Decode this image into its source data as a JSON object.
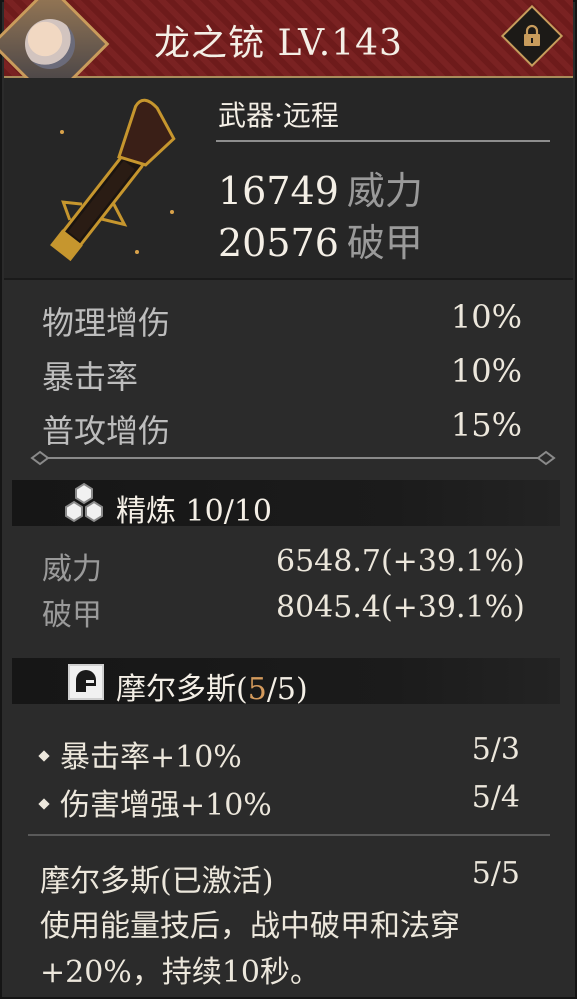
{
  "header": {
    "title": "龙之铳 LV.143"
  },
  "weapon": {
    "category": "武器·远程",
    "stats": [
      {
        "value": "16749",
        "label": "威力"
      },
      {
        "value": "20576",
        "label": "破甲"
      }
    ]
  },
  "attributes": [
    {
      "label": "物理增伤",
      "value": "10%"
    },
    {
      "label": "暴击率",
      "value": "10%"
    },
    {
      "label": "普攻增伤",
      "value": "15%"
    }
  ],
  "refine": {
    "label": "精炼 10/10",
    "rows": [
      {
        "label": "威力",
        "value": "6548.7(+39.1%)"
      },
      {
        "label": "破甲",
        "value": "8045.4(+39.1%)"
      }
    ]
  },
  "set": {
    "name": "摩尔多斯(",
    "count_highlight": "5",
    "count_rest": "/5)",
    "bonuses": [
      {
        "label": "暴击率+10%",
        "value": "5/3"
      },
      {
        "label": "伤害增强+10%",
        "value": "5/4"
      }
    ],
    "active_label": "摩尔多斯(已激活)",
    "active_value": "5/5",
    "description_line1": "使用能量技后，战中破甲和法穿",
    "description_line2": "+20%，持续10秒。"
  },
  "colors": {
    "header_bg": "#7a2222",
    "highlight": "#d49a5c",
    "gold_border": "#c89c5c"
  }
}
